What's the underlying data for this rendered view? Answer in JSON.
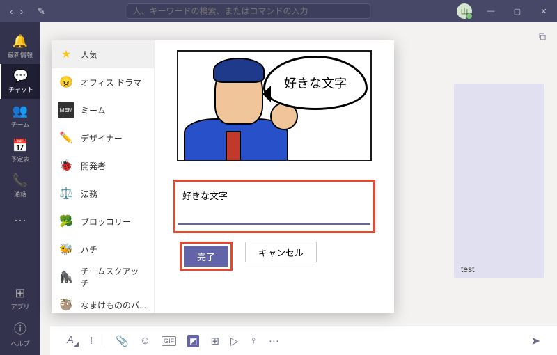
{
  "search_placeholder": "人、キーワードの検索、またはコマンドの入力",
  "avatar_initial": "山",
  "rail": [
    {
      "label": "最新情報"
    },
    {
      "label": "チャット"
    },
    {
      "label": "チーム"
    },
    {
      "label": "予定表"
    },
    {
      "label": "通話"
    }
  ],
  "rail_apps": "アプリ",
  "rail_help": "ヘルプ",
  "categories": [
    {
      "label": "人気"
    },
    {
      "label": "オフィス ドラマ"
    },
    {
      "label": "ミーム"
    },
    {
      "label": "デザイナー"
    },
    {
      "label": "開発者"
    },
    {
      "label": "法務"
    },
    {
      "label": "ブロッコリー"
    },
    {
      "label": "ハチ"
    },
    {
      "label": "チームスクアッチ"
    },
    {
      "label": "なまけもののバ..."
    }
  ],
  "bubble_text": "好きな文字",
  "input_value": "好きな文字",
  "btn_done": "完了",
  "btn_cancel": "キャンセル",
  "message_preview": "test"
}
